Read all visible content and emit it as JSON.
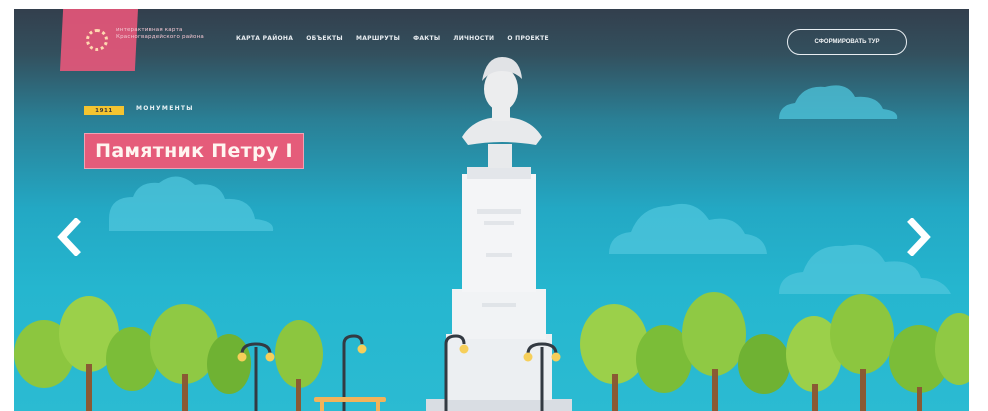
{
  "header": {
    "logo_text": "интерактивная карта Красногвардейского района",
    "nav_items": [
      "КАРТА РАЙОНА",
      "ОБЪЕКТЫ",
      "МАРШРУТЫ",
      "ФАКТЫ",
      "ЛИЧНОСТИ",
      "О ПРОЕКТЕ"
    ],
    "tour_button": "СФОРМИРОВАТЬ ТУР"
  },
  "hero": {
    "year": "1911",
    "category": "МОНУМЕНТЫ",
    "title": "Памятник Петру I"
  },
  "colors": {
    "accent_pink": "#e55c7a",
    "badge_yellow": "#f4c430",
    "sky_blue": "#25b6cf",
    "header_dark": "#333f4d"
  },
  "icons": {
    "prev": "chevron-left-icon",
    "next": "chevron-right-icon",
    "logo": "dotted-circle-logo"
  }
}
